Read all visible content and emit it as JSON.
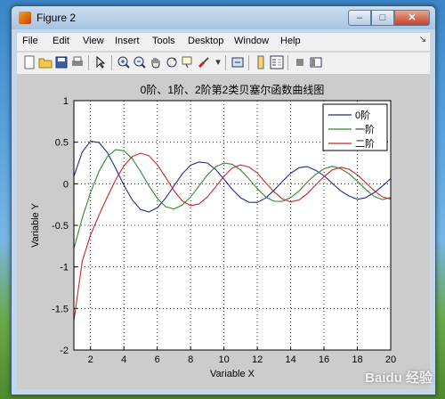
{
  "window": {
    "title": "Figure 2",
    "min_symbol": "–",
    "max_symbol": "□",
    "close_symbol": "✕"
  },
  "menu": {
    "items": [
      "File",
      "Edit",
      "View",
      "Insert",
      "Tools",
      "Desktop",
      "Window",
      "Help"
    ],
    "arrow": "↘"
  },
  "toolbar": {
    "icons": [
      "new-figure",
      "open-file",
      "save",
      "print",
      "edit-plot",
      "zoom-in",
      "zoom-out",
      "pan",
      "rotate-3d",
      "data-cursor",
      "brush",
      "link-plot",
      "colorbar",
      "legend",
      "hide-plot-tools",
      "show-plot-tools"
    ]
  },
  "watermark": "Baidu 经验",
  "colors": {
    "j0": "#1f2a8c",
    "j1": "#2f8a2f",
    "j2": "#c8262a"
  },
  "chart_data": {
    "type": "line",
    "title": "0阶、1阶、2阶第2类贝塞尔函数曲线图",
    "xlabel": "Variable X",
    "ylabel": "Variable Y",
    "xlim": [
      1,
      20
    ],
    "ylim": [
      -2,
      1
    ],
    "xticks": [
      2,
      4,
      6,
      8,
      10,
      12,
      14,
      16,
      18,
      20
    ],
    "yticks": [
      -2,
      -1.5,
      -1,
      -0.5,
      0,
      0.5,
      1
    ],
    "ytick_labels": [
      "-2",
      "-1.5",
      "-1",
      "-0.5",
      "0",
      "0.5",
      "1"
    ],
    "grid": true,
    "legend_position": "top-right",
    "x": [
      1,
      1.5,
      2,
      2.5,
      3,
      3.5,
      4,
      4.5,
      5,
      5.5,
      6,
      6.5,
      7,
      7.5,
      8,
      8.5,
      9,
      9.5,
      10,
      10.5,
      11,
      11.5,
      12,
      12.5,
      13,
      13.5,
      14,
      14.5,
      15,
      15.5,
      16,
      16.5,
      17,
      17.5,
      18,
      18.5,
      19,
      19.5,
      20
    ],
    "series": [
      {
        "name": "0阶",
        "values": [
          0.088,
          0.382,
          0.51,
          0.498,
          0.377,
          0.19,
          -0.017,
          -0.195,
          -0.309,
          -0.339,
          -0.288,
          -0.173,
          -0.026,
          0.118,
          0.223,
          0.262,
          0.25,
          0.173,
          0.056,
          -0.067,
          -0.169,
          -0.223,
          -0.225,
          -0.171,
          -0.079,
          0.027,
          0.127,
          0.193,
          0.206,
          0.162,
          0.096,
          0.005,
          -0.085,
          -0.148,
          -0.187,
          -0.167,
          -0.108,
          -0.03,
          0.063
        ]
      },
      {
        "name": "一阶",
        "values": [
          -0.781,
          -0.412,
          -0.107,
          0.146,
          0.325,
          0.41,
          0.398,
          0.301,
          0.148,
          -0.024,
          -0.175,
          -0.276,
          -0.303,
          -0.256,
          -0.158,
          -0.028,
          0.104,
          0.205,
          0.249,
          0.235,
          0.164,
          0.059,
          -0.057,
          -0.158,
          -0.21,
          -0.212,
          -0.167,
          -0.087,
          0.021,
          0.113,
          0.18,
          0.21,
          0.181,
          0.119,
          0.031,
          -0.068,
          -0.152,
          -0.19,
          -0.166
        ]
      },
      {
        "name": "二阶",
        "values": [
          -1.651,
          -0.932,
          -0.617,
          -0.381,
          -0.161,
          0.045,
          0.216,
          0.328,
          0.368,
          0.337,
          0.23,
          0.078,
          -0.082,
          -0.206,
          -0.263,
          -0.244,
          -0.16,
          -0.037,
          0.089,
          0.19,
          0.227,
          0.201,
          0.13,
          0.013,
          -0.095,
          -0.183,
          -0.217,
          -0.196,
          -0.12,
          -0.013,
          0.085,
          0.167,
          0.199,
          0.175,
          0.108,
          0.013,
          -0.081,
          -0.157,
          -0.185
        ]
      }
    ]
  }
}
